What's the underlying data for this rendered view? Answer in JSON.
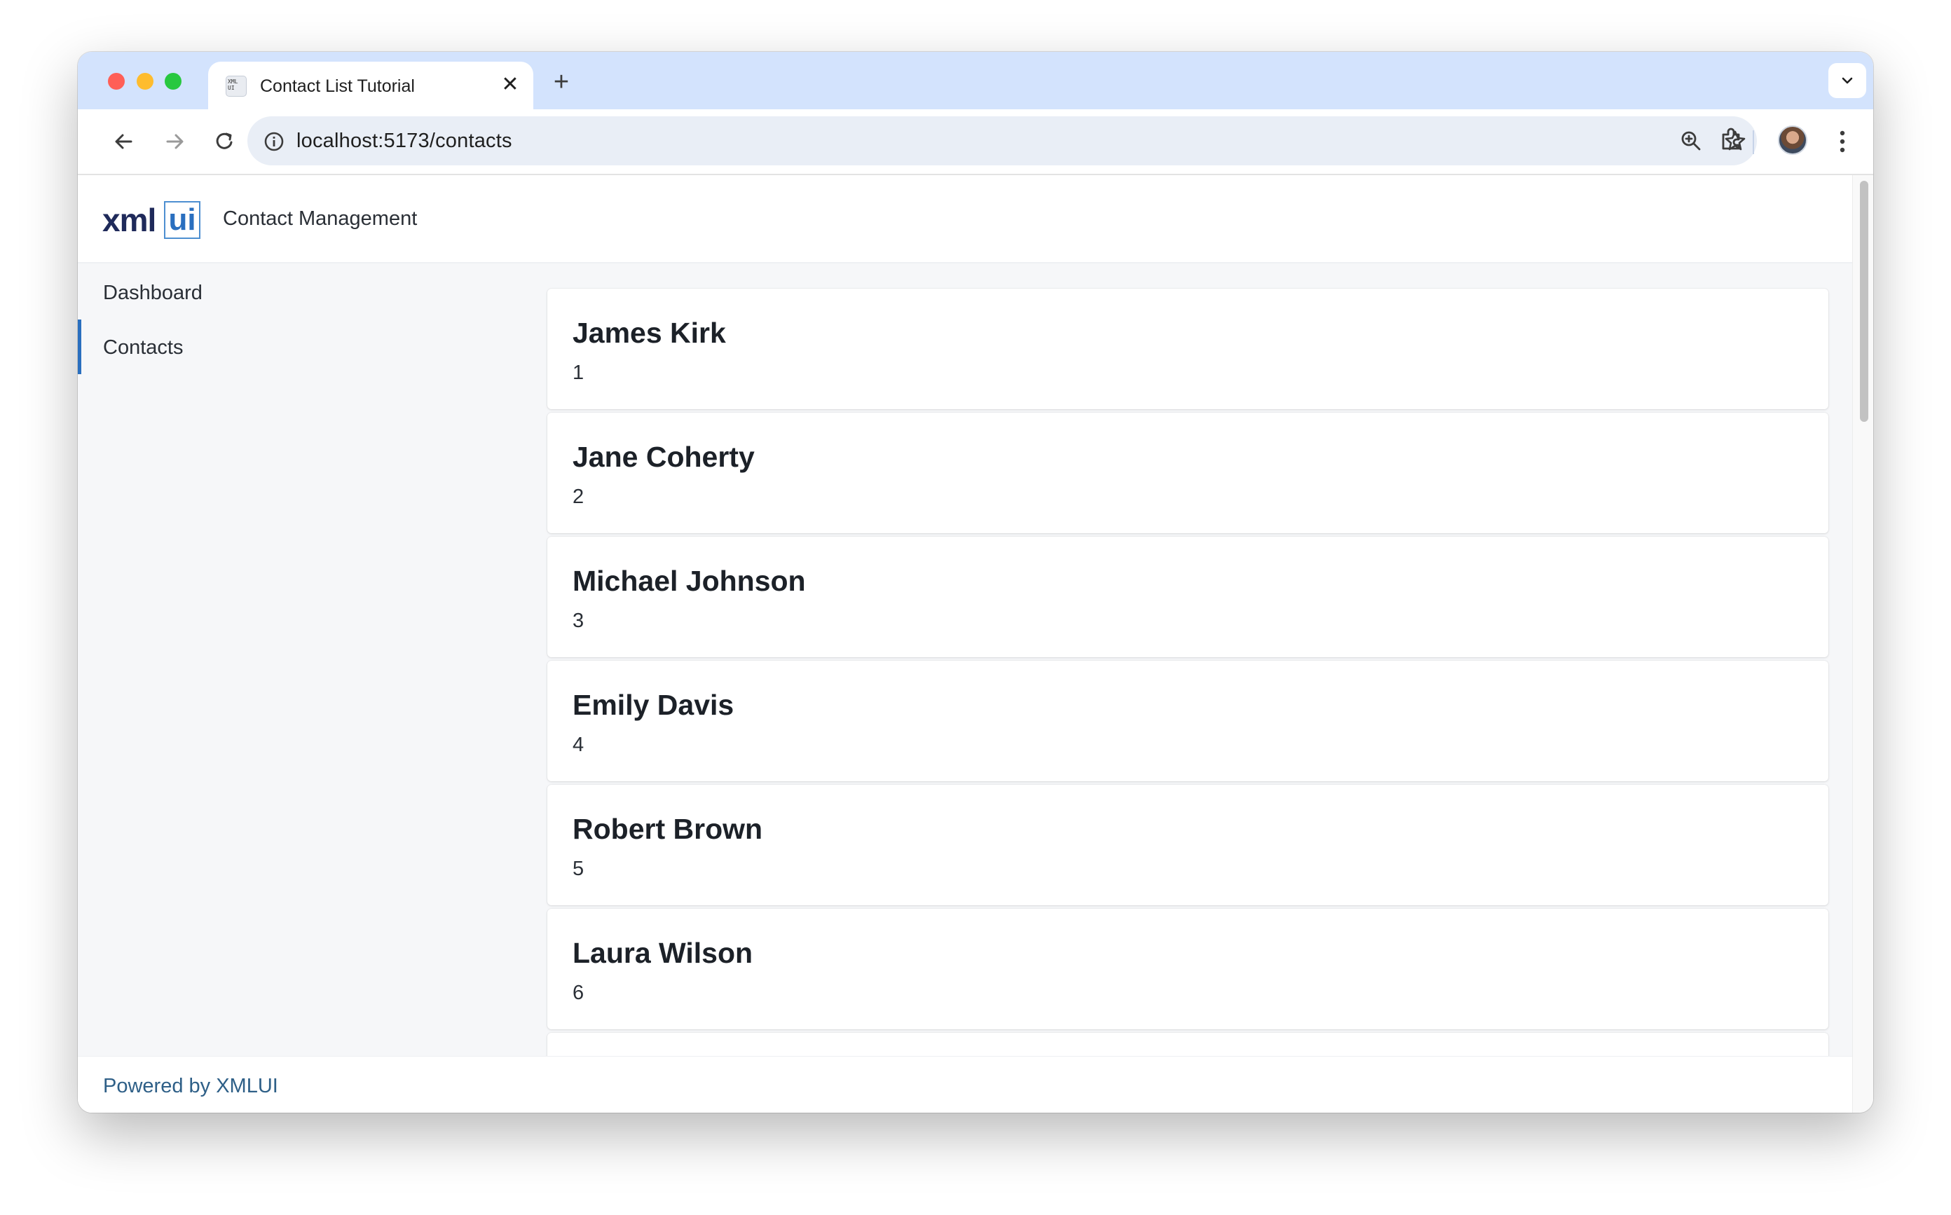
{
  "browser": {
    "tab_title": "Contact List Tutorial",
    "tab_favicon_text": "XML UI",
    "new_tab_symbol": "+",
    "close_symbol": "✕",
    "url": "localhost:5173/contacts"
  },
  "app": {
    "logo_xml": "xml",
    "logo_ui": "ui",
    "title": "Contact Management",
    "footer": "Powered by XMLUI"
  },
  "sidebar": {
    "items": [
      {
        "label": "Dashboard",
        "active": false
      },
      {
        "label": "Contacts",
        "active": true
      }
    ]
  },
  "contacts": [
    {
      "name": "James Kirk",
      "id": "1"
    },
    {
      "name": "Jane Coherty",
      "id": "2"
    },
    {
      "name": "Michael Johnson",
      "id": "3"
    },
    {
      "name": "Emily Davis",
      "id": "4"
    },
    {
      "name": "Robert Brown",
      "id": "5"
    },
    {
      "name": "Laura Wilson",
      "id": "6"
    },
    {
      "name": "",
      "id": ""
    }
  ],
  "colors": {
    "tabstrip": "#d3e3fd",
    "accent": "#2a6fbf",
    "footer_text": "#2e5f87"
  }
}
